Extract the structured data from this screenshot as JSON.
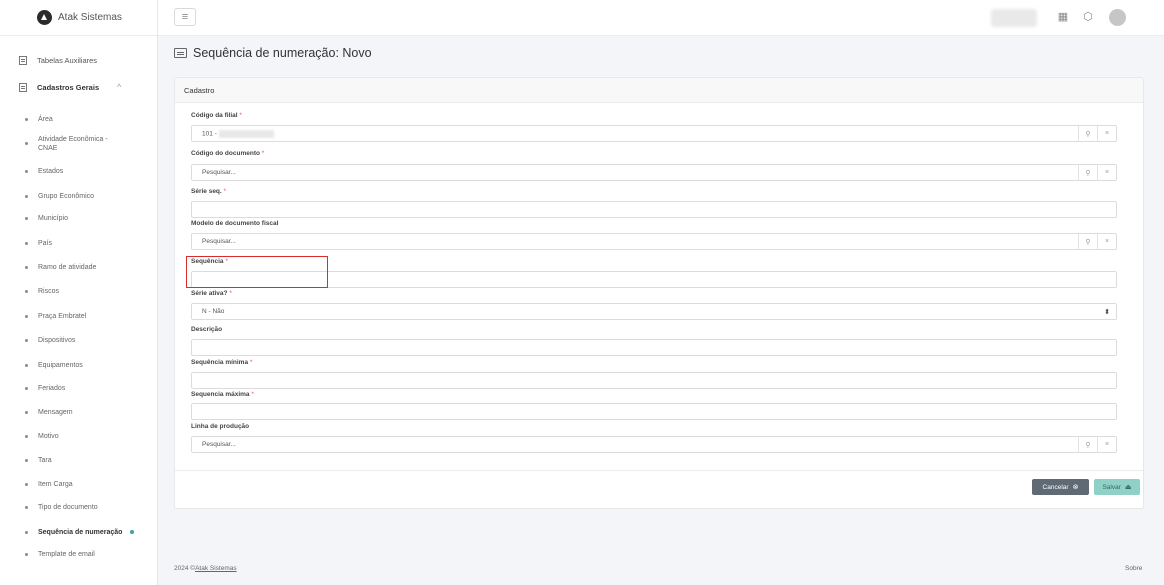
{
  "brand": {
    "name": "Atak Sistemas"
  },
  "sidebar": {
    "groups": [
      {
        "label": "Tabelas Auxiliares"
      },
      {
        "label": "Cadastros Gerais",
        "chevron": "^"
      }
    ],
    "items": [
      {
        "label": "Área"
      },
      {
        "label": "Atividade Econômica - CNAE"
      },
      {
        "label": "Estados"
      },
      {
        "label": "Grupo Econômico"
      },
      {
        "label": "Município"
      },
      {
        "label": "País"
      },
      {
        "label": "Ramo de atividade"
      },
      {
        "label": "Riscos"
      },
      {
        "label": "Praça Embratel"
      },
      {
        "label": "Dispositivos"
      },
      {
        "label": "Equipamentos"
      },
      {
        "label": "Feriados"
      },
      {
        "label": "Mensagem"
      },
      {
        "label": "Motivo"
      },
      {
        "label": "Tara"
      },
      {
        "label": "Item Carga"
      },
      {
        "label": "Tipo de documento"
      },
      {
        "label": "Sequência de numeração"
      },
      {
        "label": "Template de email"
      }
    ]
  },
  "page": {
    "title": "Sequência de numeração: Novo"
  },
  "card": {
    "title": "Cadastro"
  },
  "form": {
    "codigo_filial": {
      "label": "Código da filial",
      "value": "101 -"
    },
    "codigo_documento": {
      "label": "Código do documento",
      "placeholder": "Pesquisar..."
    },
    "serie_seq": {
      "label": "Série seq."
    },
    "modelo_documento": {
      "label": "Modelo de documento fiscal",
      "placeholder": "Pesquisar..."
    },
    "sequencia": {
      "label": "Sequência"
    },
    "serie_ativa": {
      "label": "Série ativa?",
      "value": "N - Não"
    },
    "descricao": {
      "label": "Descrição"
    },
    "sequencia_minima": {
      "label": "Sequência mínima"
    },
    "sequencia_maxima": {
      "label": "Sequencia máxima"
    },
    "linha_producao": {
      "label": "Linha de produção",
      "placeholder": "Pesquisar..."
    },
    "required_mark": "*"
  },
  "actions": {
    "cancel": "Cancelar",
    "save": "Salvar"
  },
  "footer": {
    "year": "2024 ©",
    "company": "Atak Sistemas",
    "about": "Sobre"
  },
  "colors": {
    "accent": "#3aa3a8",
    "save": "#8fd0c7",
    "cancel": "#5f6a74",
    "highlight": "#d92c2c"
  }
}
